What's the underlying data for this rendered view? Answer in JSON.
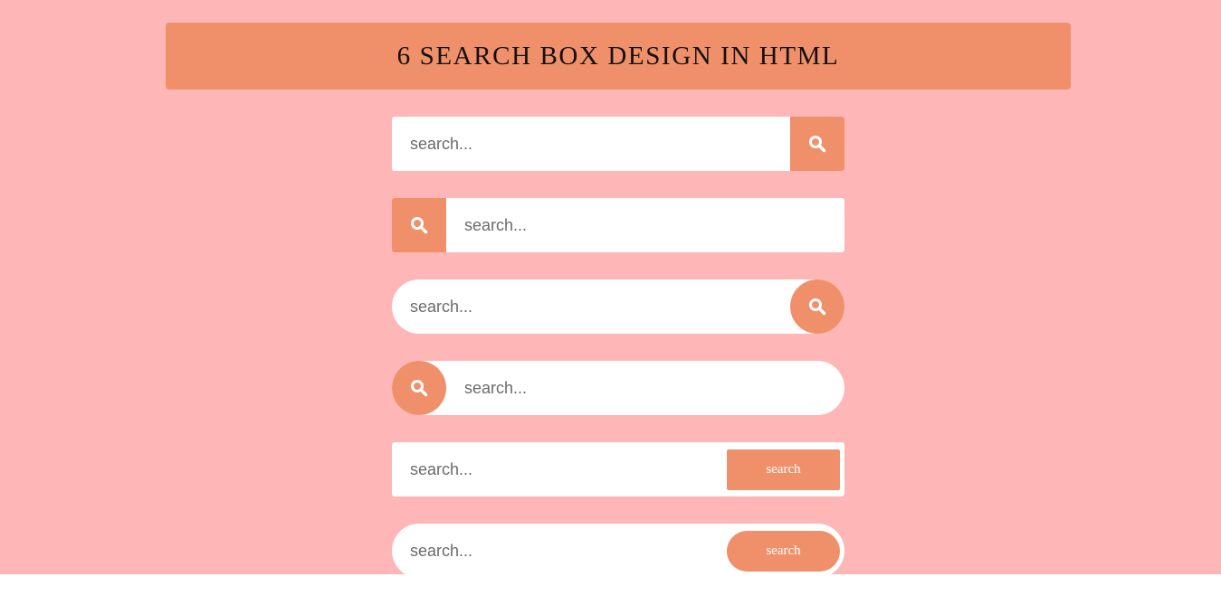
{
  "header": {
    "title": "6 SEARCH BOX DESIGN IN HTML"
  },
  "colors": {
    "background": "#ffb6b6",
    "accent": "#f0906a",
    "field": "#ffffff"
  },
  "search_boxes": [
    {
      "style": "square",
      "button": "search-icon",
      "button_side": "right",
      "placeholder": "search..."
    },
    {
      "style": "square",
      "button": "search-icon",
      "button_side": "left",
      "placeholder": "search..."
    },
    {
      "style": "rounded",
      "button": "search-icon",
      "button_side": "right",
      "placeholder": "search..."
    },
    {
      "style": "rounded",
      "button": "search-icon",
      "button_side": "left",
      "placeholder": "search..."
    },
    {
      "style": "square",
      "button": "text",
      "button_label": "search",
      "button_side": "right",
      "placeholder": "search..."
    },
    {
      "style": "rounded",
      "button": "text",
      "button_label": "search",
      "button_side": "right",
      "placeholder": "search..."
    }
  ]
}
